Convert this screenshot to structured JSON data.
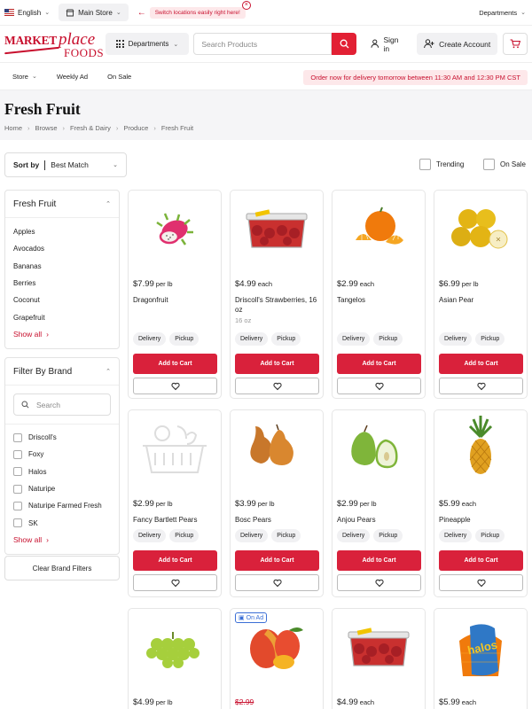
{
  "topbar": {
    "language": "English",
    "store": "Main Store",
    "switch_tip": "Switch locations easily right here!",
    "departments": "Departments"
  },
  "header": {
    "logo": {
      "line1": "MARKET",
      "line2": "place",
      "line3": "FOODS"
    },
    "departments": "Departments",
    "search_placeholder": "Search Products",
    "sign_in": "Sign in",
    "create_account": "Create Account"
  },
  "nav": {
    "store": "Store",
    "weekly_ad": "Weekly Ad",
    "on_sale": "On Sale",
    "delivery_banner": "Order now for delivery tomorrow between 11:30 AM and 12:30 PM CST"
  },
  "page": {
    "title": "Fresh Fruit",
    "breadcrumbs": [
      "Home",
      "Browse",
      "Fresh & Dairy",
      "Produce",
      "Fresh Fruit"
    ]
  },
  "sort": {
    "label": "Sort by",
    "value": "Best Match"
  },
  "filters": {
    "trending": "Trending",
    "on_sale": "On Sale"
  },
  "sidebar": {
    "category": {
      "title": "Fresh Fruit",
      "items": [
        "Apples",
        "Avocados",
        "Bananas",
        "Berries",
        "Coconut",
        "Grapefruit"
      ],
      "show_all": "Show all"
    },
    "brand": {
      "title": "Filter By Brand",
      "search_placeholder": "Search",
      "items": [
        "Driscoll's",
        "Foxy",
        "Halos",
        "Naturipe",
        "Naturipe Farmed Fresh",
        "SK"
      ],
      "show_all": "Show all"
    },
    "clear_button": "Clear Brand Filters"
  },
  "product_common": {
    "delivery": "Delivery",
    "pickup": "Pickup",
    "add_to_cart": "Add to Cart",
    "on_ad": "On Ad"
  },
  "products": [
    {
      "price": "$7.99",
      "unit": "per lb",
      "name": "Dragonfruit",
      "image": "dragonfruit"
    },
    {
      "price": "$4.99",
      "unit": "each",
      "name": "Driscoll's Strawberries, 16 oz",
      "size": "16 oz",
      "image": "strawberries"
    },
    {
      "price": "$2.99",
      "unit": "each",
      "name": "Tangelos",
      "image": "tangelos"
    },
    {
      "price": "$6.99",
      "unit": "per lb",
      "name": "Asian Pear",
      "image": "asian-pear"
    },
    {
      "price": "$2.99",
      "unit": "per lb",
      "name": "Fancy Bartlett Pears",
      "image": "placeholder-basket"
    },
    {
      "price": "$3.99",
      "unit": "per lb",
      "name": "Bosc Pears",
      "image": "bosc-pears"
    },
    {
      "price": "$2.99",
      "unit": "per lb",
      "name": "Anjou Pears",
      "image": "anjou-pears"
    },
    {
      "price": "$5.99",
      "unit": "each",
      "name": "Pineapple",
      "image": "pineapple"
    },
    {
      "price": "$4.99",
      "unit": "per lb",
      "image": "grapes"
    },
    {
      "old_price": "$2.99",
      "image": "mangoes",
      "on_ad": true
    },
    {
      "price": "$4.99",
      "unit": "each",
      "image": "strawberries"
    },
    {
      "price": "$5.99",
      "unit": "each",
      "image": "halos",
      "brand_text": "halos"
    }
  ],
  "colors": {
    "brand": "#c8102e",
    "button": "#d9213b",
    "on_ad": "#3b6fd6"
  }
}
